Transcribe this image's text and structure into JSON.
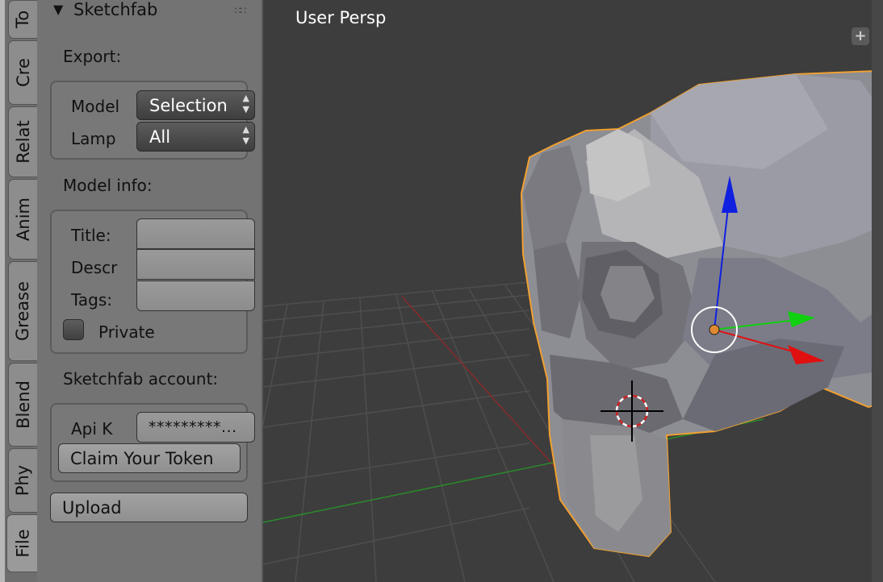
{
  "tabs": [
    {
      "label": "To"
    },
    {
      "label": "Cre"
    },
    {
      "label": "Relat"
    },
    {
      "label": "Anim"
    },
    {
      "label": "Grease"
    },
    {
      "label": "Blend"
    },
    {
      "label": "Phy"
    },
    {
      "label": "File"
    }
  ],
  "panel": {
    "title": "Sketchfab",
    "export": {
      "label": "Export:",
      "model_label": "Model",
      "model_value": "Selection",
      "lamp_label": "Lamp",
      "lamp_value": "All"
    },
    "model_info": {
      "label": "Model info:",
      "title_label": "Title:",
      "title_value": "",
      "descr_label": "Descr",
      "descr_value": "",
      "tags_label": "Tags:",
      "tags_value": "",
      "private_label": "Private",
      "private_checked": false
    },
    "account": {
      "label": "Sketchfab account:",
      "api_label": "Api K",
      "api_value": "*********...",
      "claim_button": "Claim Your Token"
    },
    "upload_button": "Upload"
  },
  "viewport": {
    "view_label": "User Persp",
    "plus_label": "+"
  },
  "colors": {
    "selection_outline": "#f0a030",
    "axis_x": "#e01010",
    "axis_y": "#10d010",
    "axis_z": "#1020e0",
    "origin": "#e08a30"
  }
}
